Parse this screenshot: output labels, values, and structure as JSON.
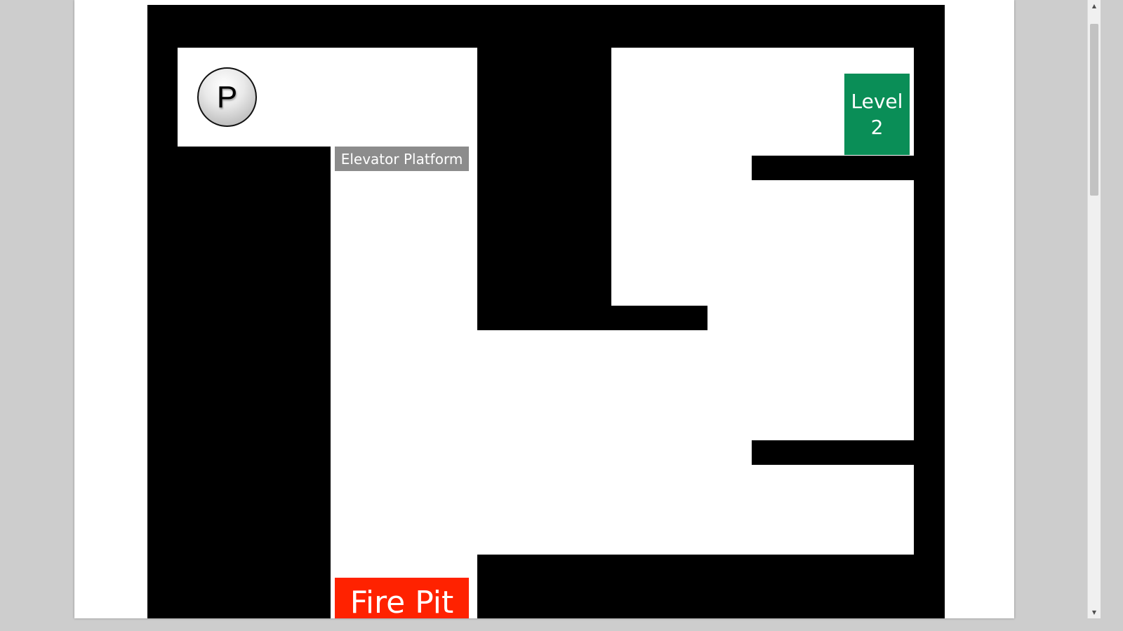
{
  "game": {
    "player_label": "P",
    "elevator_label": "Elevator Platform",
    "level_label_line1": "Level",
    "level_label_line2": "2",
    "firepit_label": "Fire Pit"
  },
  "colors": {
    "wall": "#000000",
    "floor": "#ffffff",
    "elevator": "#8c8c8c",
    "level_goal": "#0a8e57",
    "fire_pit": "#ff2200"
  },
  "scrollbar": {
    "up_icon": "▲",
    "down_icon": "▼"
  }
}
